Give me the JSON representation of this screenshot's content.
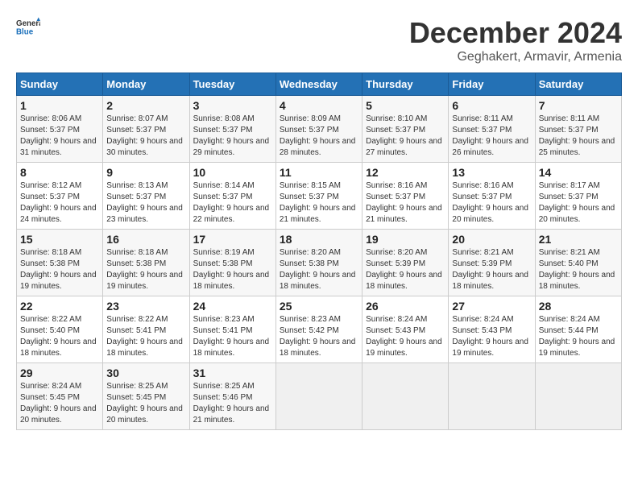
{
  "logo": {
    "general": "General",
    "blue": "Blue"
  },
  "title": "December 2024",
  "location": "Geghakert, Armavir, Armenia",
  "days_of_week": [
    "Sunday",
    "Monday",
    "Tuesday",
    "Wednesday",
    "Thursday",
    "Friday",
    "Saturday"
  ],
  "weeks": [
    [
      {
        "day": "1",
        "sunrise": "8:06 AM",
        "sunset": "5:37 PM",
        "daylight": "9 hours and 31 minutes."
      },
      {
        "day": "2",
        "sunrise": "8:07 AM",
        "sunset": "5:37 PM",
        "daylight": "9 hours and 30 minutes."
      },
      {
        "day": "3",
        "sunrise": "8:08 AM",
        "sunset": "5:37 PM",
        "daylight": "9 hours and 29 minutes."
      },
      {
        "day": "4",
        "sunrise": "8:09 AM",
        "sunset": "5:37 PM",
        "daylight": "9 hours and 28 minutes."
      },
      {
        "day": "5",
        "sunrise": "8:10 AM",
        "sunset": "5:37 PM",
        "daylight": "9 hours and 27 minutes."
      },
      {
        "day": "6",
        "sunrise": "8:11 AM",
        "sunset": "5:37 PM",
        "daylight": "9 hours and 26 minutes."
      },
      {
        "day": "7",
        "sunrise": "8:11 AM",
        "sunset": "5:37 PM",
        "daylight": "9 hours and 25 minutes."
      }
    ],
    [
      {
        "day": "8",
        "sunrise": "8:12 AM",
        "sunset": "5:37 PM",
        "daylight": "9 hours and 24 minutes."
      },
      {
        "day": "9",
        "sunrise": "8:13 AM",
        "sunset": "5:37 PM",
        "daylight": "9 hours and 23 minutes."
      },
      {
        "day": "10",
        "sunrise": "8:14 AM",
        "sunset": "5:37 PM",
        "daylight": "9 hours and 22 minutes."
      },
      {
        "day": "11",
        "sunrise": "8:15 AM",
        "sunset": "5:37 PM",
        "daylight": "9 hours and 21 minutes."
      },
      {
        "day": "12",
        "sunrise": "8:16 AM",
        "sunset": "5:37 PM",
        "daylight": "9 hours and 21 minutes."
      },
      {
        "day": "13",
        "sunrise": "8:16 AM",
        "sunset": "5:37 PM",
        "daylight": "9 hours and 20 minutes."
      },
      {
        "day": "14",
        "sunrise": "8:17 AM",
        "sunset": "5:37 PM",
        "daylight": "9 hours and 20 minutes."
      }
    ],
    [
      {
        "day": "15",
        "sunrise": "8:18 AM",
        "sunset": "5:38 PM",
        "daylight": "9 hours and 19 minutes."
      },
      {
        "day": "16",
        "sunrise": "8:18 AM",
        "sunset": "5:38 PM",
        "daylight": "9 hours and 19 minutes."
      },
      {
        "day": "17",
        "sunrise": "8:19 AM",
        "sunset": "5:38 PM",
        "daylight": "9 hours and 18 minutes."
      },
      {
        "day": "18",
        "sunrise": "8:20 AM",
        "sunset": "5:38 PM",
        "daylight": "9 hours and 18 minutes."
      },
      {
        "day": "19",
        "sunrise": "8:20 AM",
        "sunset": "5:39 PM",
        "daylight": "9 hours and 18 minutes."
      },
      {
        "day": "20",
        "sunrise": "8:21 AM",
        "sunset": "5:39 PM",
        "daylight": "9 hours and 18 minutes."
      },
      {
        "day": "21",
        "sunrise": "8:21 AM",
        "sunset": "5:40 PM",
        "daylight": "9 hours and 18 minutes."
      }
    ],
    [
      {
        "day": "22",
        "sunrise": "8:22 AM",
        "sunset": "5:40 PM",
        "daylight": "9 hours and 18 minutes."
      },
      {
        "day": "23",
        "sunrise": "8:22 AM",
        "sunset": "5:41 PM",
        "daylight": "9 hours and 18 minutes."
      },
      {
        "day": "24",
        "sunrise": "8:23 AM",
        "sunset": "5:41 PM",
        "daylight": "9 hours and 18 minutes."
      },
      {
        "day": "25",
        "sunrise": "8:23 AM",
        "sunset": "5:42 PM",
        "daylight": "9 hours and 18 minutes."
      },
      {
        "day": "26",
        "sunrise": "8:24 AM",
        "sunset": "5:43 PM",
        "daylight": "9 hours and 19 minutes."
      },
      {
        "day": "27",
        "sunrise": "8:24 AM",
        "sunset": "5:43 PM",
        "daylight": "9 hours and 19 minutes."
      },
      {
        "day": "28",
        "sunrise": "8:24 AM",
        "sunset": "5:44 PM",
        "daylight": "9 hours and 19 minutes."
      }
    ],
    [
      {
        "day": "29",
        "sunrise": "8:24 AM",
        "sunset": "5:45 PM",
        "daylight": "9 hours and 20 minutes."
      },
      {
        "day": "30",
        "sunrise": "8:25 AM",
        "sunset": "5:45 PM",
        "daylight": "9 hours and 20 minutes."
      },
      {
        "day": "31",
        "sunrise": "8:25 AM",
        "sunset": "5:46 PM",
        "daylight": "9 hours and 21 minutes."
      },
      null,
      null,
      null,
      null
    ]
  ]
}
